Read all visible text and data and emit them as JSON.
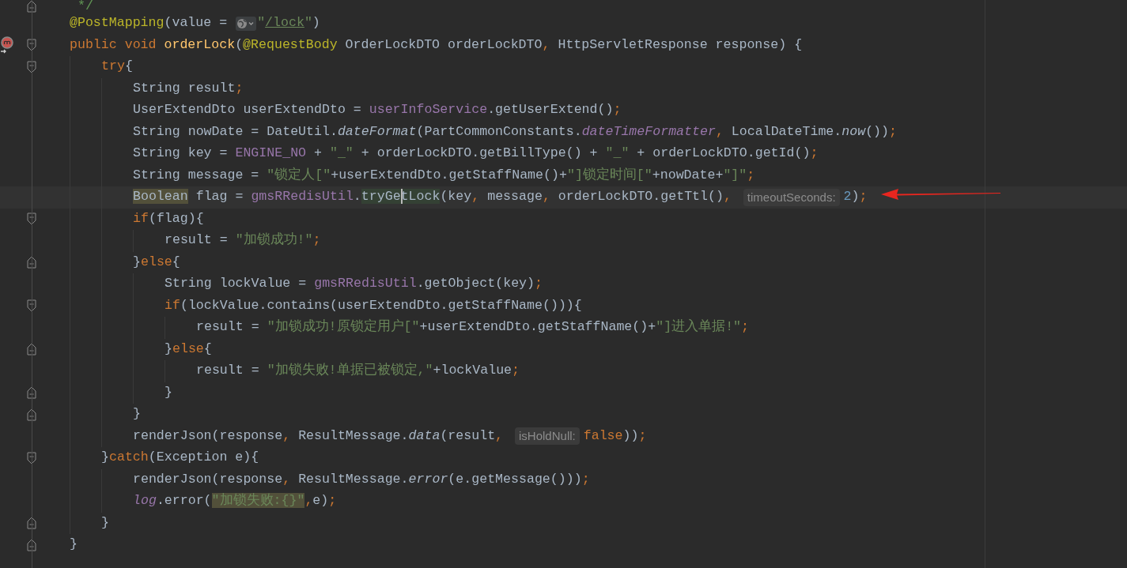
{
  "editor": {
    "lines": [
      {
        "fold_end": true,
        "tokens": [
          {
            "kind": "comment",
            "text": " */"
          }
        ]
      },
      {
        "tokens": [
          {
            "kind": "ann",
            "text": "@PostMapping"
          },
          {
            "kind": "plain",
            "text": "(value = "
          },
          {
            "kind": "globe"
          },
          {
            "kind": "str",
            "text": "\""
          },
          {
            "kind": "link",
            "text": "/lock"
          },
          {
            "kind": "str",
            "text": "\""
          },
          {
            "kind": "plain",
            "text": ")"
          }
        ]
      },
      {
        "fold_start": true,
        "method_icon": true,
        "tokens": [
          {
            "kind": "kw",
            "text": "public void "
          },
          {
            "kind": "fn",
            "text": "orderLock"
          },
          {
            "kind": "plain",
            "text": "("
          },
          {
            "kind": "ann",
            "text": "@RequestBody"
          },
          {
            "kind": "plain",
            "text": " OrderLockDTO orderLockDTO"
          },
          {
            "kind": "punct",
            "text": ", "
          },
          {
            "kind": "plain",
            "text": "HttpServletResponse response) {"
          }
        ],
        "children": [
          {
            "fold_start": true,
            "tokens": [
              {
                "kind": "kw",
                "text": "try"
              },
              {
                "kind": "plain",
                "text": "{"
              }
            ],
            "children": [
              {
                "tokens": [
                  {
                    "kind": "plain",
                    "text": "String result"
                  },
                  {
                    "kind": "punct",
                    "text": ";"
                  }
                ]
              },
              {
                "tokens": [
                  {
                    "kind": "plain",
                    "text": "UserExtendDto userExtendDto = "
                  },
                  {
                    "kind": "fld",
                    "text": "userInfoService"
                  },
                  {
                    "kind": "plain",
                    "text": ".getUserExtend()"
                  },
                  {
                    "kind": "punct",
                    "text": ";"
                  }
                ]
              },
              {
                "tokens": [
                  {
                    "kind": "plain",
                    "text": "String nowDate = DateUtil."
                  },
                  {
                    "kind": "ital",
                    "text": "dateFormat"
                  },
                  {
                    "kind": "plain",
                    "text": "(PartCommonConstants."
                  },
                  {
                    "kind": "italfld",
                    "text": "dateTimeFormatter"
                  },
                  {
                    "kind": "punct",
                    "text": ", "
                  },
                  {
                    "kind": "plain",
                    "text": "LocalDateTime."
                  },
                  {
                    "kind": "ital",
                    "text": "now"
                  },
                  {
                    "kind": "plain",
                    "text": "())"
                  },
                  {
                    "kind": "punct",
                    "text": ";"
                  }
                ]
              },
              {
                "tokens": [
                  {
                    "kind": "plain",
                    "text": "String key = "
                  },
                  {
                    "kind": "fld",
                    "text": "ENGINE_NO"
                  },
                  {
                    "kind": "plain",
                    "text": " + "
                  },
                  {
                    "kind": "str",
                    "text": "\"_\""
                  },
                  {
                    "kind": "plain",
                    "text": " + orderLockDTO.getBillType() + "
                  },
                  {
                    "kind": "str",
                    "text": "\"_\""
                  },
                  {
                    "kind": "plain",
                    "text": " + orderLockDTO.getId()"
                  },
                  {
                    "kind": "punct",
                    "text": ";"
                  }
                ]
              },
              {
                "tokens": [
                  {
                    "kind": "plain",
                    "text": "String message = "
                  },
                  {
                    "kind": "str",
                    "text": "\"锁定人[\""
                  },
                  {
                    "kind": "plain",
                    "text": "+userExtendDto.getStaffName()+"
                  },
                  {
                    "kind": "str",
                    "text": "\"]锁定时间[\""
                  },
                  {
                    "kind": "plain",
                    "text": "+nowDate+"
                  },
                  {
                    "kind": "str",
                    "text": "\"]\""
                  },
                  {
                    "kind": "punct",
                    "text": ";"
                  }
                ]
              },
              {
                "current": true,
                "tokens": [
                  {
                    "kind": "plain",
                    "text": "Boolean",
                    "highlighted": true
                  },
                  {
                    "kind": "plain",
                    "text": " flag = "
                  },
                  {
                    "kind": "fld",
                    "text": "gmsRRedisUtil"
                  },
                  {
                    "kind": "plain",
                    "text": "."
                  },
                  {
                    "kind": "plain",
                    "text": "tryGetLock",
                    "caret": true
                  },
                  {
                    "kind": "plain",
                    "text": "(key"
                  },
                  {
                    "kind": "punct",
                    "text": ", "
                  },
                  {
                    "kind": "plain",
                    "text": "message"
                  },
                  {
                    "kind": "punct",
                    "text": ", "
                  },
                  {
                    "kind": "plain",
                    "text": "orderLockDTO.getTtl()"
                  },
                  {
                    "kind": "punct",
                    "text": ", "
                  },
                  {
                    "kind": "hint",
                    "text": "timeoutSeconds:"
                  },
                  {
                    "kind": "num",
                    "text": "2"
                  },
                  {
                    "kind": "plain",
                    "text": ")"
                  },
                  {
                    "kind": "punct",
                    "text": ";"
                  }
                ]
              },
              {
                "fold_start": true,
                "tokens": [
                  {
                    "kind": "kw",
                    "text": "if"
                  },
                  {
                    "kind": "plain",
                    "text": "(flag){"
                  }
                ],
                "children": [
                  {
                    "tokens": [
                      {
                        "kind": "plain",
                        "text": "result = "
                      },
                      {
                        "kind": "str",
                        "text": "\"加锁成功!\""
                      },
                      {
                        "kind": "punct",
                        "text": ";"
                      }
                    ]
                  }
                ]
              },
              {
                "fold_end": true,
                "tokens": [
                  {
                    "kind": "plain",
                    "text": "}"
                  },
                  {
                    "kind": "kw",
                    "text": "else"
                  },
                  {
                    "kind": "plain",
                    "text": "{"
                  }
                ],
                "children": [
                  {
                    "tokens": [
                      {
                        "kind": "plain",
                        "text": "String lockValue = "
                      },
                      {
                        "kind": "fld",
                        "text": "gmsRRedisUtil"
                      },
                      {
                        "kind": "plain",
                        "text": ".getObject(key)"
                      },
                      {
                        "kind": "punct",
                        "text": ";"
                      }
                    ]
                  },
                  {
                    "fold_start": true,
                    "tokens": [
                      {
                        "kind": "kw",
                        "text": "if"
                      },
                      {
                        "kind": "plain",
                        "text": "(lockValue.contains(userExtendDto.getStaffName())){"
                      }
                    ],
                    "children": [
                      {
                        "tokens": [
                          {
                            "kind": "plain",
                            "text": "result = "
                          },
                          {
                            "kind": "str",
                            "text": "\"加锁成功!原锁定用户[\""
                          },
                          {
                            "kind": "plain",
                            "text": "+userExtendDto.getStaffName()+"
                          },
                          {
                            "kind": "str",
                            "text": "\"]进入单据!\""
                          },
                          {
                            "kind": "punct",
                            "text": ";"
                          }
                        ]
                      }
                    ]
                  },
                  {
                    "fold_end": true,
                    "tokens": [
                      {
                        "kind": "plain",
                        "text": "}"
                      },
                      {
                        "kind": "kw",
                        "text": "else"
                      },
                      {
                        "kind": "plain",
                        "text": "{"
                      }
                    ],
                    "children": [
                      {
                        "tokens": [
                          {
                            "kind": "plain",
                            "text": "result = "
                          },
                          {
                            "kind": "str",
                            "text": "\"加锁失败!单据已被锁定,\""
                          },
                          {
                            "kind": "plain",
                            "text": "+lockValue"
                          },
                          {
                            "kind": "punct",
                            "text": ";"
                          }
                        ]
                      }
                    ]
                  },
                  {
                    "fold_end": true,
                    "tokens": [
                      {
                        "kind": "plain",
                        "text": "}"
                      }
                    ]
                  }
                ]
              },
              {
                "fold_end": true,
                "tokens": [
                  {
                    "kind": "plain",
                    "text": "}"
                  }
                ]
              },
              {
                "tokens": [
                  {
                    "kind": "plain",
                    "text": "renderJson(response"
                  },
                  {
                    "kind": "punct",
                    "text": ", "
                  },
                  {
                    "kind": "plain",
                    "text": "ResultMessage."
                  },
                  {
                    "kind": "ital",
                    "text": "data"
                  },
                  {
                    "kind": "plain",
                    "text": "(result"
                  },
                  {
                    "kind": "punct",
                    "text": ", "
                  },
                  {
                    "kind": "hint",
                    "text": "isHoldNull:"
                  },
                  {
                    "kind": "kw",
                    "text": "false"
                  },
                  {
                    "kind": "plain",
                    "text": "))"
                  },
                  {
                    "kind": "punct",
                    "text": ";"
                  }
                ]
              }
            ]
          },
          {
            "fold_start": true,
            "tokens": [
              {
                "kind": "plain",
                "text": "}"
              },
              {
                "kind": "kw",
                "text": "catch"
              },
              {
                "kind": "plain",
                "text": "(Exception e){"
              }
            ],
            "children": [
              {
                "tokens": [
                  {
                    "kind": "plain",
                    "text": "renderJson(response"
                  },
                  {
                    "kind": "punct",
                    "text": ", "
                  },
                  {
                    "kind": "plain",
                    "text": "ResultMessage."
                  },
                  {
                    "kind": "ital",
                    "text": "error"
                  },
                  {
                    "kind": "plain",
                    "text": "(e.getMessage()))"
                  },
                  {
                    "kind": "punct",
                    "text": ";"
                  }
                ]
              },
              {
                "tokens": [
                  {
                    "kind": "italfld",
                    "text": "log"
                  },
                  {
                    "kind": "plain",
                    "text": ".error("
                  },
                  {
                    "kind": "str",
                    "text": "\"加锁失败:{}\"",
                    "highlighted": true
                  },
                  {
                    "kind": "punct",
                    "text": ","
                  },
                  {
                    "kind": "plain",
                    "text": "e)"
                  },
                  {
                    "kind": "punct",
                    "text": ";"
                  }
                ]
              }
            ]
          },
          {
            "fold_end": true,
            "tokens": [
              {
                "kind": "plain",
                "text": "}"
              }
            ]
          }
        ]
      },
      {
        "fold_end": true,
        "tokens": [
          {
            "kind": "plain",
            "text": "}"
          }
        ]
      }
    ]
  }
}
